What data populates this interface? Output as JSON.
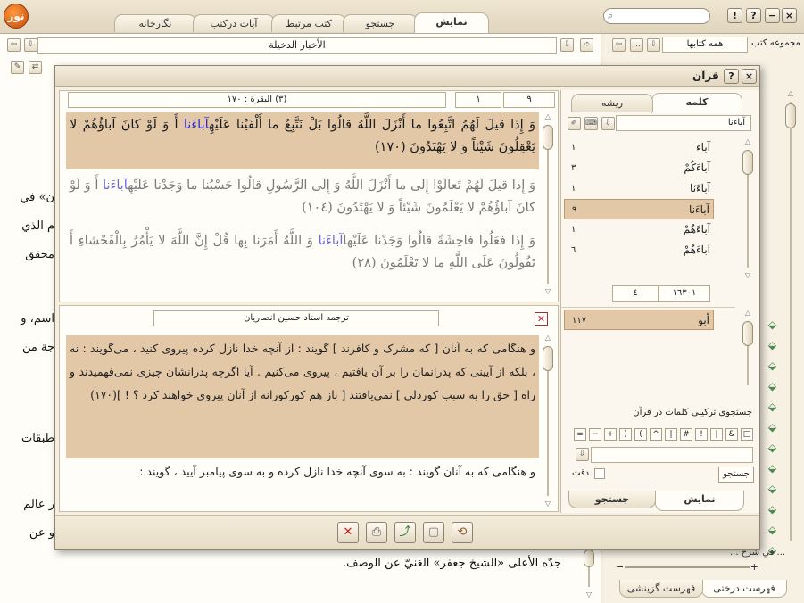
{
  "tabs": [
    "نمایش",
    "جستجو",
    "کتب مرتبط",
    "آیات درکتب",
    "نگارخانه"
  ],
  "window_buttons": {
    "close": "×",
    "help": "?",
    "about": "!"
  },
  "search": {
    "placeholder": ""
  },
  "book_title": "الأخبار الدخيلة",
  "collection": {
    "label": "مجموعه کتب",
    "value": "همه کتابها"
  },
  "sidebar_tabs": [
    "فهرست درختی",
    "فهرست گزینشی"
  ],
  "sidebar_bottom_item": "... في شرح ...",
  "background_text": [
    "ن» في",
    "م الذي",
    "محقق",
    "اسم، و",
    "جة من",
    "طبقات",
    "ر عالم",
    "و عن",
    "جدّه الأعلى «الشيخ جعفر» الغنيّ عن الوصف."
  ],
  "quran_dialog": {
    "title": "قرآن",
    "help_button": "?",
    "close_button": "×",
    "left_tabs": [
      "کلمه",
      "ریشه"
    ],
    "word_field": "آباءنا",
    "words": [
      {
        "word": "آباء",
        "count": "١"
      },
      {
        "word": "آباءَكُمْ",
        "count": "٣"
      },
      {
        "word": "آباءَنَا",
        "count": "١"
      },
      {
        "word": "آباءَنا",
        "count": "٩"
      },
      {
        "word": "آباءَهُمْ",
        "count": "١"
      },
      {
        "word": "آباءَهُمْ",
        "count": "٦"
      }
    ],
    "pager": {
      "current": "٤",
      "total": "١٦٣٠١"
    },
    "roots": [
      {
        "root": "أبو",
        "count": "١١٧"
      }
    ],
    "combo_search_label": "جستجوی ترکیبی کلمات در قرآن",
    "operators": [
      "□",
      "&",
      "|",
      "!",
      "#",
      "|",
      "^",
      "(",
      ")",
      "+",
      "−",
      "="
    ],
    "search_button": "جستجو",
    "exact_label": "دقت",
    "bottom_tabs": [
      "نمایش",
      "جستجو"
    ],
    "sura_field": "(٣) البقرة : ١٧٠",
    "nav": {
      "verse_count": "٩",
      "current": "١"
    },
    "verses": [
      {
        "before": "وَ إِذا قيلَ لَهُمُ اتَّبِعُوا ما أَنْزَلَ اللَّهُ قالُوا بَلْ نَتَّبِعُ ما أَلْفَيْنا عَلَيْهِ",
        "highlight": "آباءَنا",
        "after": " أَ وَ لَوْ كانَ آباؤُهُمْ لا يَعْقِلُونَ شَيْئاً وَ لا يَهْتَدُونَ (١٧٠)"
      },
      {
        "before": "وَ إِذا قيلَ لَهُمْ تَعالَوْا إِلى‏ ما أَنْزَلَ اللَّهُ وَ إِلَى الرَّسُولِ قالُوا حَسْبُنا ما وَجَدْنا عَلَيْهِ",
        "highlight": "آباءَنا",
        "after": " أَ وَ لَوْ كانَ آباؤُهُمْ لا يَعْلَمُونَ شَيْئاً وَ لا يَهْتَدُونَ (١٠٤)"
      },
      {
        "before": "وَ إِذا فَعَلُوا فاحِشَةً قالُوا وَجَدْنا عَلَيْها",
        "highlight": "آباءَنا",
        "after": " وَ اللَّهُ أَمَرَنا بِها قُلْ إِنَّ اللَّهَ لا يَأْمُرُ بِالْفَحْشاءِ أَ تَقُولُونَ عَلَى اللَّهِ ما لا تَعْلَمُونَ (٢٨)"
      }
    ],
    "translator": "ترجمه استاد حسین انصاریان",
    "translation_1": "و هنگامی که به آنان [ که مشرک و کافرند ] گویند : از آنچه خدا نازل کرده پیروی کنید ، می‌گویند : نه ، بلکه از آیینی که پدرانمان را بر آن یافتیم ، پیروی می‌کنیم . آیا اگرچه پدرانشان چیزی نمی‌فهمیدند و راه [ حق را به سبب کوردلی ] نمی‌یافتند [ باز هم کورکورانه از آنان پیروی خواهند کرد ؟ ! ](١٧٠)",
    "translation_2": "و هنگامی که به آنان گویند : به سوی آنچه خدا نازل کرده و به سوی پیامبر آیید ، گویند :",
    "accent_highlight": "#2b2bd6",
    "selected_bg": "#e3c8a8"
  }
}
